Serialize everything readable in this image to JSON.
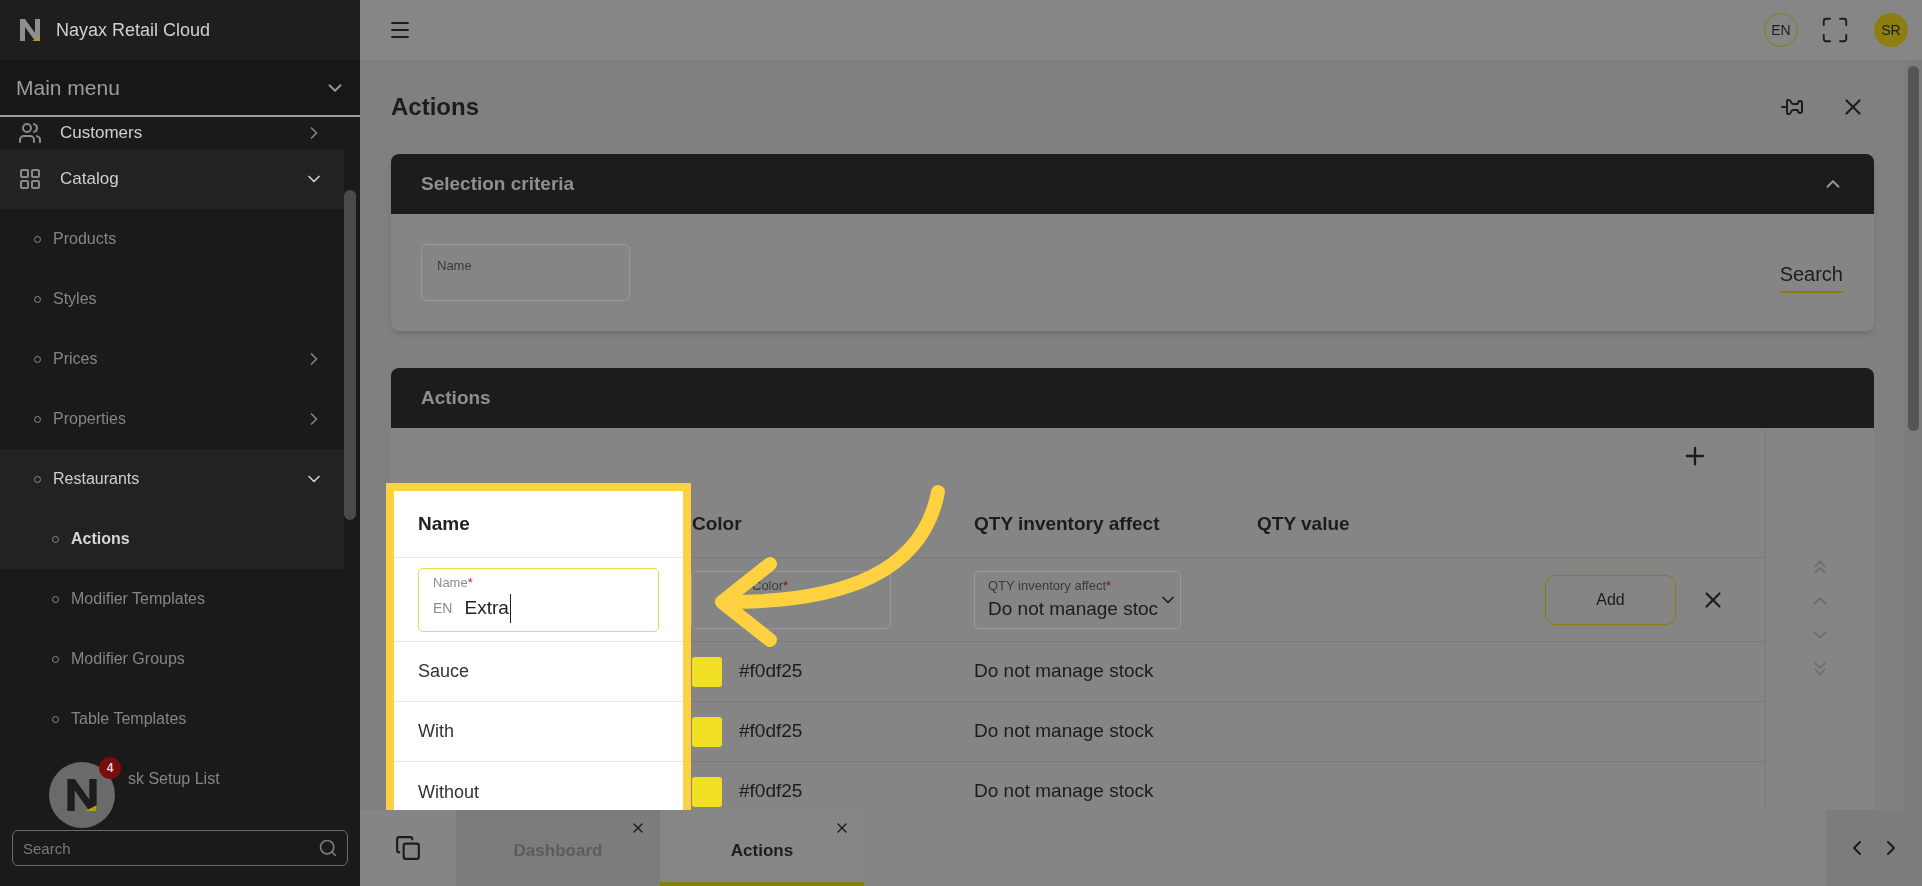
{
  "app": {
    "title": "Nayax Retail Cloud"
  },
  "sidebar": {
    "menu_label": "Main menu",
    "items": [
      {
        "label": "Customers",
        "expanded": false
      },
      {
        "label": "Catalog",
        "expanded": true,
        "children": [
          {
            "label": "Products",
            "selected": false
          },
          {
            "label": "Styles",
            "selected": false
          },
          {
            "label": "Prices",
            "expanded": false,
            "selected": false
          },
          {
            "label": "Properties",
            "expanded": false,
            "selected": false
          },
          {
            "label": "Restaurants",
            "expanded": true,
            "selected": false,
            "children": [
              {
                "label": "Actions",
                "selected": true
              },
              {
                "label": "Modifier Templates",
                "selected": false
              },
              {
                "label": "Modifier Groups",
                "selected": false
              },
              {
                "label": "Table Templates",
                "selected": false
              },
              {
                "label": "sk Setup List",
                "selected": false,
                "kind": "covered"
              }
            ]
          }
        ]
      }
    ],
    "search": {
      "placeholder": "Search"
    },
    "assistant_badge": "4"
  },
  "header": {
    "language": "EN",
    "user_initials": "SR"
  },
  "page": {
    "title": "Actions"
  },
  "selection_criteria": {
    "title": "Selection criteria",
    "expanded": true,
    "name_field": {
      "label": "Name"
    },
    "search_button": "Search"
  },
  "actions_card": {
    "title": "Actions",
    "columns": [
      "Name",
      "Color",
      "QTY inventory affect",
      "QTY value"
    ],
    "new_row": {
      "name_label": "Name",
      "name_required": "*",
      "name_prefix": "EN",
      "name_value": "Extra",
      "color_label": "Color",
      "color_required": "*",
      "qty_label": "QTY inventory affect",
      "qty_required": "*",
      "qty_value": "Do not manage stoc",
      "add_button": "Add"
    },
    "rows": [
      {
        "name": "Sauce",
        "color": "#f0df25",
        "qty_inventory_affect": "Do not manage stock"
      },
      {
        "name": "With",
        "color": "#f0df25",
        "qty_inventory_affect": "Do not manage stock"
      },
      {
        "name": "Without",
        "color": "#f0df25",
        "qty_inventory_affect": "Do not manage stock"
      }
    ]
  },
  "tabs": [
    {
      "label": "Dashboard",
      "selected": false
    },
    {
      "label": "Actions",
      "selected": true
    }
  ]
}
